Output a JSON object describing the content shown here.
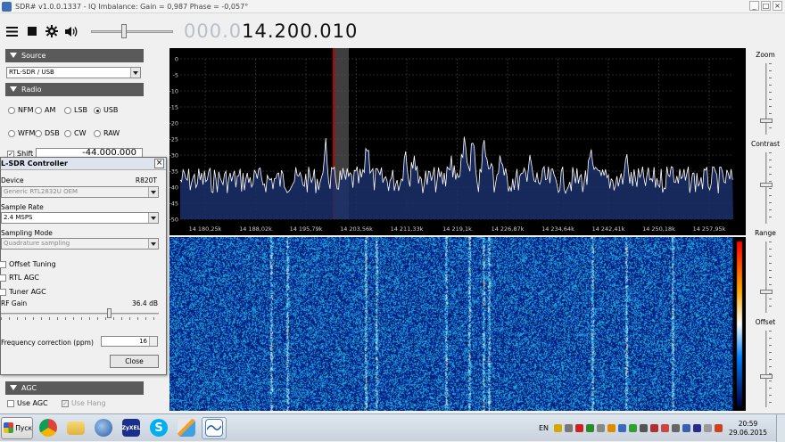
{
  "window": {
    "title": "SDR# v1.0.0.1337 - IQ Imbalance: Gain = 0,987 Phase = -0,057°",
    "minimize": "_",
    "maximize": "□",
    "close": "×"
  },
  "toolbar": {
    "menu_icon": "hamburger-icon",
    "stop_icon": "stop-icon",
    "settings_icon": "gear-icon",
    "audio_icon": "speaker-icon",
    "volume_level": 0.4,
    "frequency_dim": "000.0",
    "frequency_bright": "14.200.010"
  },
  "source": {
    "header": "Source",
    "device": "RTL-SDR / USB"
  },
  "radio": {
    "header": "Radio",
    "modes_row1": [
      "NFM",
      "AM",
      "LSB",
      "USB"
    ],
    "modes_row2": [
      "WFM",
      "DSB",
      "CW",
      "RAW"
    ],
    "selected": "USB",
    "shift_label": "Shift",
    "shift_value": "-44.000.000"
  },
  "rtl_dialog": {
    "title": "L-SDR Controller",
    "device_label": "Device",
    "device_model": "R820T",
    "device_value": "Generic RTL2832U OEM",
    "sample_rate_label": "Sample Rate",
    "sample_rate_value": "2.4 MSPS",
    "sampling_mode_label": "Sampling Mode",
    "sampling_mode_value": "Quadrature sampling",
    "offset_tuning": "Offset Tuning",
    "rtl_agc": "RTL AGC",
    "tuner_agc": "Tuner AGC",
    "rf_gain_label": "RF Gain",
    "rf_gain_value": "36.4 dB",
    "rf_gain_level": 0.69,
    "freq_corr_label": "Frequency correction (ppm)",
    "freq_corr_value": "16",
    "close_button": "Close"
  },
  "agc": {
    "header": "AGC",
    "use_agc": "Use AGC",
    "use_hang": "Use Hang"
  },
  "spectrum": {
    "db_ticks": [
      "0",
      "-5",
      "-10",
      "-15",
      "-20",
      "-25",
      "-30",
      "-35",
      "-40",
      "-45",
      "-50"
    ],
    "freq_ticks": [
      "14 180,25k",
      "14 188,02k",
      "14 195,79k",
      "14 203,56k",
      "14 211,33k",
      "14 219,1k",
      "14 226,87k",
      "14 234,64k",
      "14 242,41k",
      "14 250,18k",
      "14 257,95k"
    ],
    "colors": {
      "trace": "#ffffff",
      "fill": "#1b2f6b",
      "filter": "#606060",
      "tuning": "#c00000"
    }
  },
  "right_panel": {
    "zoom": "Zoom",
    "contrast": "Contrast",
    "range": "Range",
    "offset": "Offset",
    "zoom_level": 0.82,
    "contrast_level": 0.45,
    "range_level": 0.72,
    "offset_level": 0.6
  },
  "taskbar": {
    "start_label": "Пуск",
    "apps": [
      "chrome-icon",
      "folder-icon",
      "thunderbird-icon",
      "zyxel-icon",
      "skype-icon",
      "paint-icon",
      "sdr-icon"
    ],
    "zyxel_text": "ZyXEL",
    "language": "EN",
    "time": "20:59",
    "date": "29.06.2015"
  }
}
